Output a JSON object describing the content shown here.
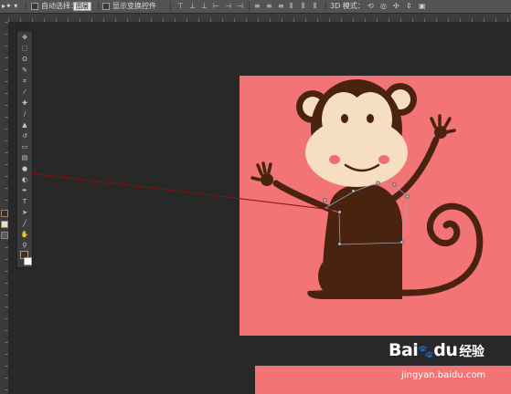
{
  "options_bar": {
    "auto_select_label": "自动选择：",
    "auto_select_value": "图层",
    "show_transform_label": "显示变换控件",
    "mode_label": "3D 模式："
  },
  "toolbox": {
    "tools": [
      "move",
      "marquee",
      "lasso",
      "quick-select",
      "crop",
      "eyedropper",
      "healing",
      "brush",
      "stamp",
      "history-brush",
      "eraser",
      "gradient",
      "blur",
      "dodge",
      "pen",
      "text",
      "path-select",
      "shape",
      "hand",
      "zoom"
    ],
    "foreground_color": "#4a2a17",
    "background_color": "#ffffff"
  },
  "canvas": {
    "background": "#f27474",
    "monkey_color": "#4a2210",
    "face_color": "#f5dfc0",
    "cheek_color": "#ef6b75"
  },
  "watermark": {
    "logo_text": "Bai",
    "logo_paw": "du",
    "logo_cn": "经验",
    "url": "jingyan.baidu.com"
  }
}
